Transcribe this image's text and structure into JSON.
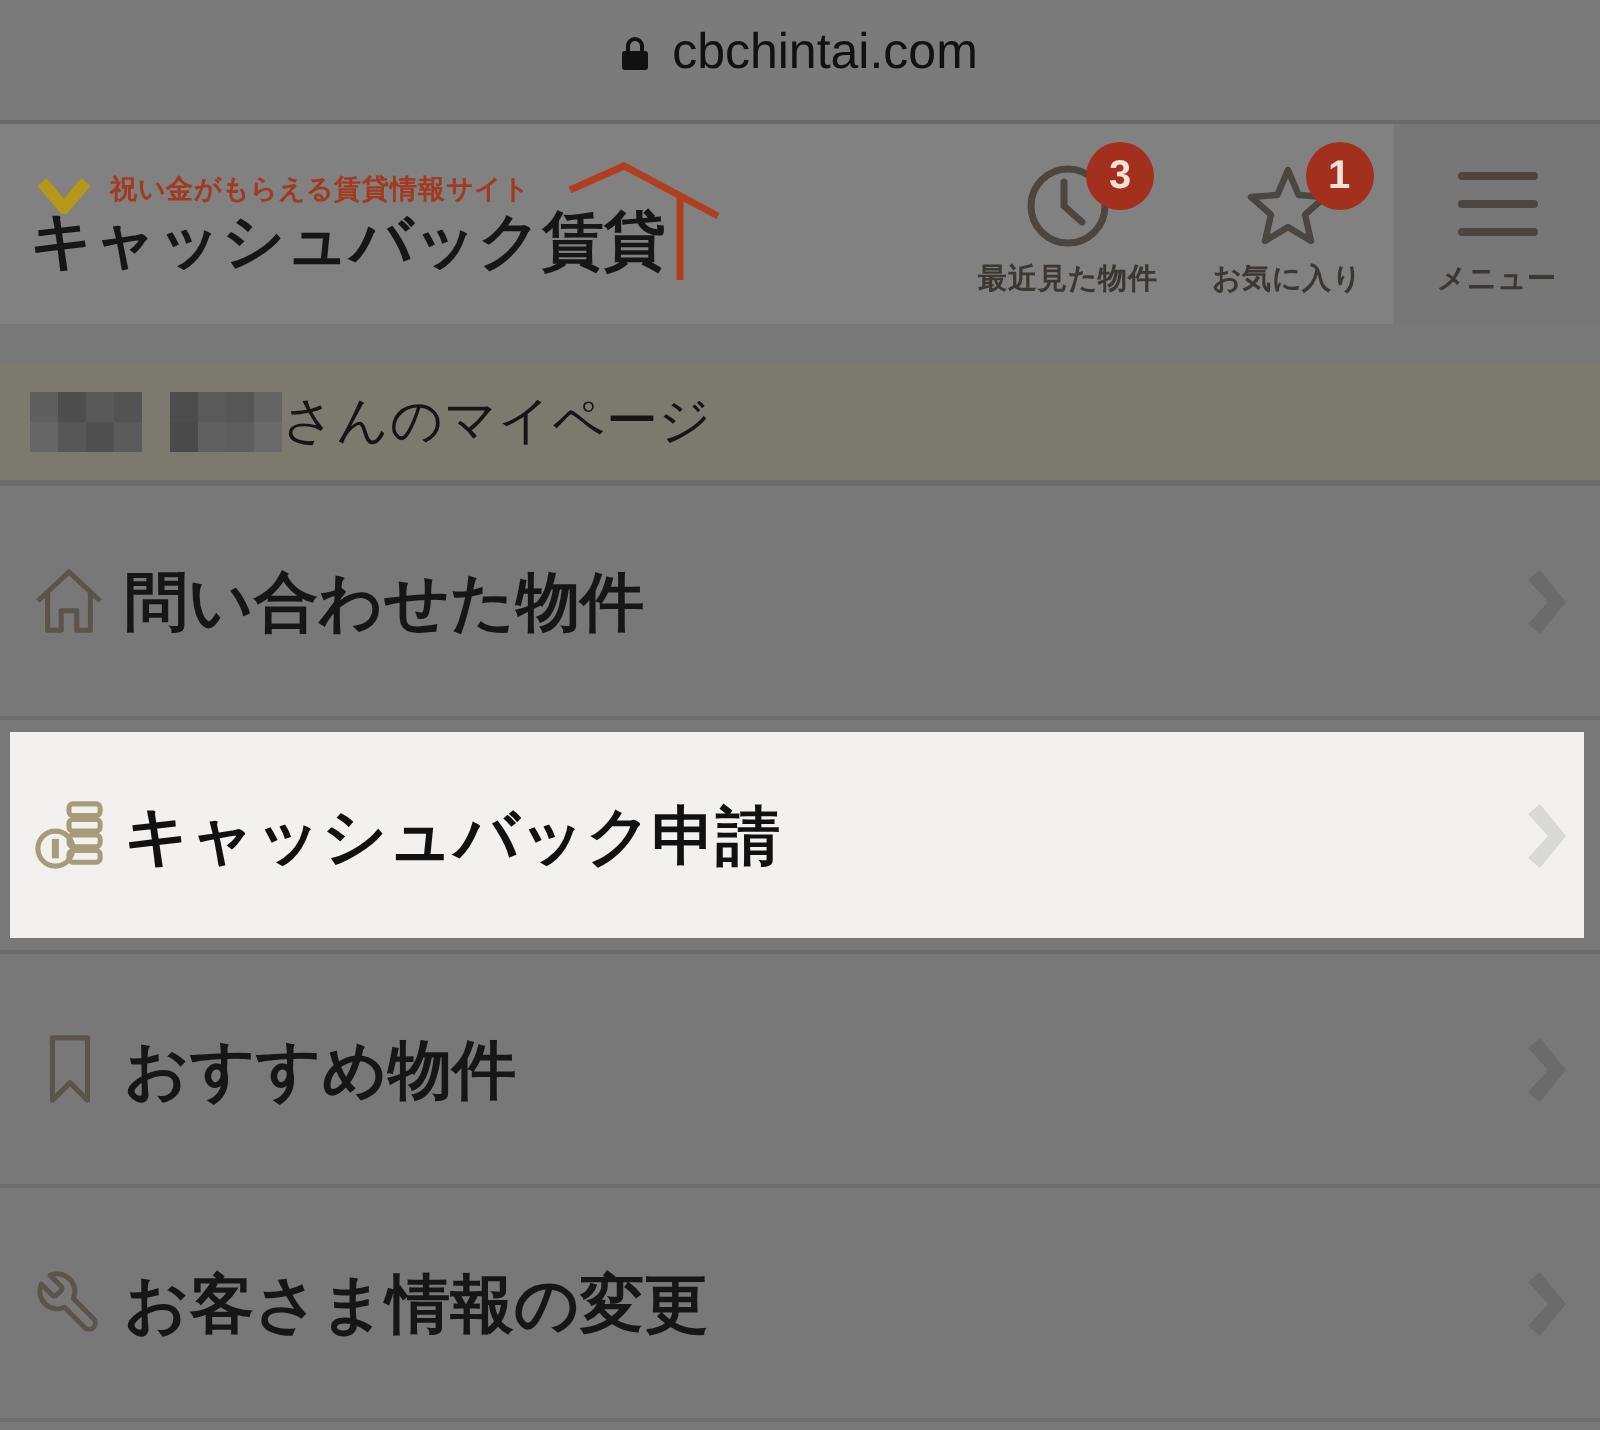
{
  "browser_bar": {
    "url": "cbchintai.com"
  },
  "header": {
    "logo": {
      "tagline": "祝い金がもらえる賃貸情報サイト",
      "name": "キャッシュバック賃貸"
    },
    "actions": [
      {
        "kind": "history",
        "label": "最近見た物件",
        "badge": "3"
      },
      {
        "kind": "favorites",
        "label": "お気に入り",
        "badge": "1"
      },
      {
        "kind": "menu",
        "label": "メニュー"
      }
    ]
  },
  "mypage": {
    "title": "さんのマイページ"
  },
  "menu_items": [
    {
      "kind": "inquiries",
      "label": "問い合わせた物件",
      "selected": false
    },
    {
      "kind": "cashback",
      "label": "キャッシュバック申請",
      "selected": true
    },
    {
      "kind": "recommended",
      "label": "おすすめ物件",
      "selected": false
    },
    {
      "kind": "profile",
      "label": "お客さま情報の変更",
      "selected": false
    }
  ]
}
